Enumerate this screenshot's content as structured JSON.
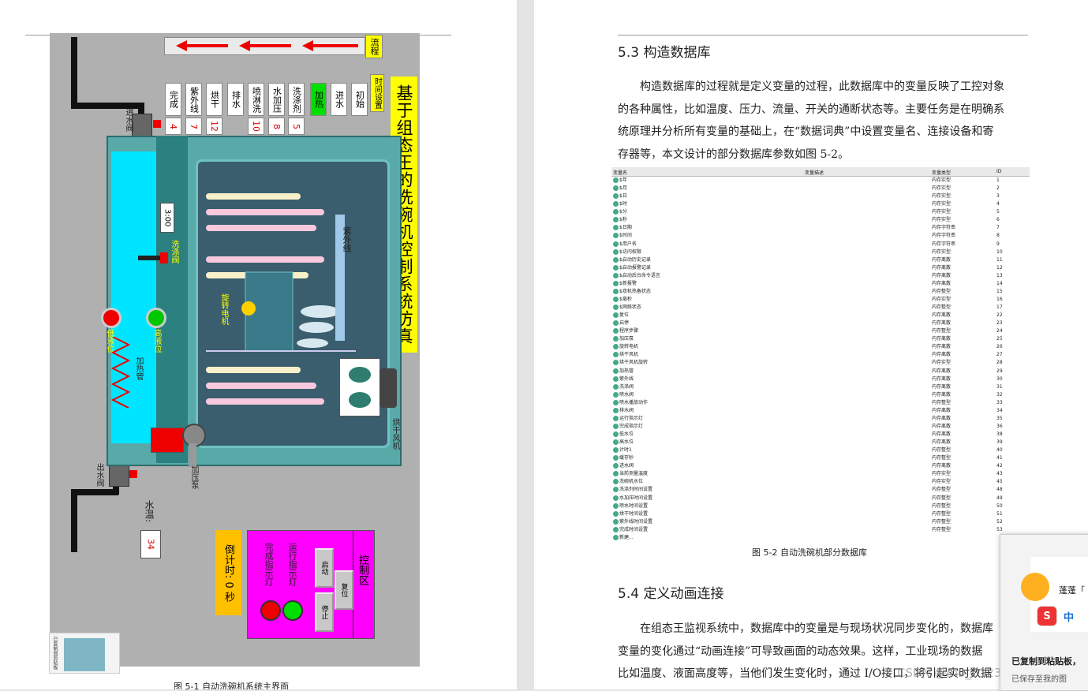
{
  "left_page": {
    "scada": {
      "title": "基于组态王的洗碗机控制系统仿真",
      "flow_label": "流程",
      "time_setting_label": "时间设置",
      "steps": [
        {
          "label": "初始",
          "value": ""
        },
        {
          "label": "进水",
          "value": ""
        },
        {
          "label": "加热",
          "value": "",
          "active": true
        },
        {
          "label": "洗涤剂",
          "value": "5"
        },
        {
          "label": "水加压",
          "value": "8"
        },
        {
          "label": "喷淋洗",
          "value": "10"
        },
        {
          "label": "排水",
          "value": ""
        },
        {
          "label": "烘干",
          "value": "12"
        },
        {
          "label": "紫外线",
          "value": "7"
        },
        {
          "label": "完成",
          "value": "4"
        }
      ],
      "inlet_valve": "进水阀",
      "outlet_valve": "出水阀",
      "time_display": "3:00",
      "detergent_valve": "洗涤阀",
      "high_level": "高液位",
      "low_level": "低液位",
      "heater": "加热管",
      "rotary_motor": "旋转电机",
      "uv_lamp": "紫外线",
      "dry_fan": "烘干风机",
      "pressure_pump": "加压泵",
      "water_temp_label": "水温:",
      "water_temp_value": "34",
      "countdown": "倒计时: 0 秒",
      "control_area": {
        "title": "控制区",
        "running_lamp": "运行指示灯",
        "done_lamp": "完成指示灯",
        "start": "启动",
        "reset": "复位",
        "stop": "停止"
      },
      "colors": {
        "tank": "#00e5ff",
        "title_bg": "#ffff00",
        "control_bg": "#ff00ff",
        "countdown_bg": "#ffc000"
      }
    },
    "caption_partial": "图 5-1 自动洗碗机系统主界面",
    "thumbnail_label": "已复制到剪贴板"
  },
  "right_page": {
    "section_53": "5.3  构造数据库",
    "para1": [
      "构造数据库的过程就是定义变量的过程，此数据库中的变量反映了工控对象",
      "的各种属性，比如温度、压力、流量、开关的通断状态等。主要任务是在明确系",
      "统原理并分析所有变量的基础上，在“数据词典”中设置变量名、连接设备和寄",
      "存器等，本文设计的部分数据库参数如图 5-2。"
    ],
    "table_headers": [
      "变量名",
      "变量描述",
      "变量类型",
      "ID"
    ],
    "table_rows": [
      [
        "$年",
        "内存实型",
        "1"
      ],
      [
        "$月",
        "内存实型",
        "2"
      ],
      [
        "$日",
        "内存实型",
        "3"
      ],
      [
        "$时",
        "内存实型",
        "4"
      ],
      [
        "$分",
        "内存实型",
        "5"
      ],
      [
        "$秒",
        "内存实型",
        "6"
      ],
      [
        "$日期",
        "内存字符串",
        "7"
      ],
      [
        "$时间",
        "内存字符串",
        "8"
      ],
      [
        "$用户名",
        "内存字符串",
        "9"
      ],
      [
        "$访问权限",
        "内存实型",
        "10"
      ],
      [
        "$启动历史记录",
        "内存离散",
        "11"
      ],
      [
        "$启动报警记录",
        "内存离散",
        "12"
      ],
      [
        "$启动后台命令语言",
        "内存离散",
        "13"
      ],
      [
        "$新报警",
        "内存离散",
        "14"
      ],
      [
        "$双机热备状态",
        "内存整型",
        "15"
      ],
      [
        "$毫秒",
        "内存实型",
        "16"
      ],
      [
        "$网络状态",
        "内存整型",
        "17"
      ],
      [
        "复位",
        "内存离散",
        "22"
      ],
      [
        "启停",
        "内存离散",
        "23"
      ],
      [
        "程序步骤",
        "内存整型",
        "24"
      ],
      [
        "加压泵",
        "内存离散",
        "25"
      ],
      [
        "旋转电机",
        "内存离散",
        "26"
      ],
      [
        "烘干风机",
        "内存离散",
        "27"
      ],
      [
        "烘干风机旋转",
        "内存实型",
        "28"
      ],
      [
        "加热管",
        "内存离散",
        "29"
      ],
      [
        "紫外线",
        "内存离散",
        "30"
      ],
      [
        "洗涤阀",
        "内存离散",
        "31"
      ],
      [
        "喷水阀",
        "内存离散",
        "32"
      ],
      [
        "喷水播放动作",
        "内存整型",
        "33"
      ],
      [
        "排水阀",
        "内存离散",
        "34"
      ],
      [
        "运行指示灯",
        "内存离散",
        "35"
      ],
      [
        "完成指示灯",
        "内存离散",
        "36"
      ],
      [
        "低水位",
        "内存离散",
        "38"
      ],
      [
        "高水位",
        "内存离散",
        "39"
      ],
      [
        "计时1",
        "内存整型",
        "40"
      ],
      [
        "缓存秒",
        "内存整型",
        "41"
      ],
      [
        "进水阀",
        "内存离散",
        "42"
      ],
      [
        "当前测量温度",
        "内存实型",
        "43"
      ],
      [
        "洗碗机水位",
        "内存实型",
        "45"
      ],
      [
        "洗涤剂时间设置",
        "内存整型",
        "48"
      ],
      [
        "水加压时间设置",
        "内存整型",
        "49"
      ],
      [
        "喷水时间设置",
        "内存整型",
        "50"
      ],
      [
        "烘干时间设置",
        "内存整型",
        "51"
      ],
      [
        "紫外线时间设置",
        "内存整型",
        "52"
      ],
      [
        "完成时间设置",
        "内存整型",
        "53"
      ],
      [
        "新建...",
        "",
        ""
      ]
    ],
    "caption_52": "图 5-2 自动洗碗机部分数据库",
    "section_54": "5.4  定义动画连接",
    "para2": [
      "在组态王监视系统中，数据库中的变量是与现场状况同步变化的，数据库",
      "变量的变化通过“动画连接”可导致画面的动态效果。这样，工业现场的数据",
      "比如温度、液面高度等，当他们发生变化时，通过 I/O接口，将引起实时数据"
    ],
    "watermark": "CSDN @m0_61237171"
  },
  "popup": {
    "name_partial": "蓬蓬「",
    "copied": "已复制到粘贴板，",
    "save_hint": "已保存至我的图"
  }
}
